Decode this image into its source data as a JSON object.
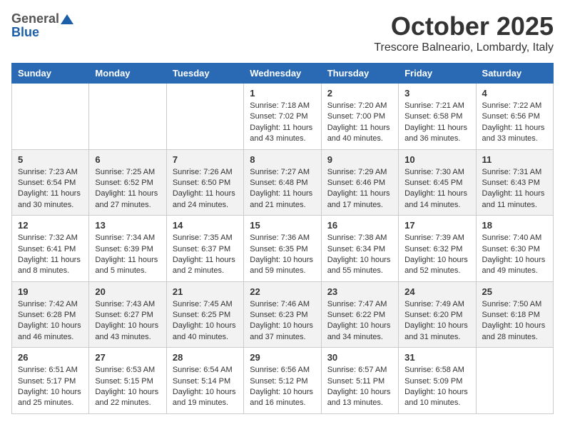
{
  "logo": {
    "general": "General",
    "blue": "Blue"
  },
  "header": {
    "month": "October 2025",
    "location": "Trescore Balneario, Lombardy, Italy"
  },
  "weekdays": [
    "Sunday",
    "Monday",
    "Tuesday",
    "Wednesday",
    "Thursday",
    "Friday",
    "Saturday"
  ],
  "weeks": [
    [
      {
        "day": "",
        "info": ""
      },
      {
        "day": "",
        "info": ""
      },
      {
        "day": "",
        "info": ""
      },
      {
        "day": "1",
        "info": "Sunrise: 7:18 AM\nSunset: 7:02 PM\nDaylight: 11 hours and 43 minutes."
      },
      {
        "day": "2",
        "info": "Sunrise: 7:20 AM\nSunset: 7:00 PM\nDaylight: 11 hours and 40 minutes."
      },
      {
        "day": "3",
        "info": "Sunrise: 7:21 AM\nSunset: 6:58 PM\nDaylight: 11 hours and 36 minutes."
      },
      {
        "day": "4",
        "info": "Sunrise: 7:22 AM\nSunset: 6:56 PM\nDaylight: 11 hours and 33 minutes."
      }
    ],
    [
      {
        "day": "5",
        "info": "Sunrise: 7:23 AM\nSunset: 6:54 PM\nDaylight: 11 hours and 30 minutes."
      },
      {
        "day": "6",
        "info": "Sunrise: 7:25 AM\nSunset: 6:52 PM\nDaylight: 11 hours and 27 minutes."
      },
      {
        "day": "7",
        "info": "Sunrise: 7:26 AM\nSunset: 6:50 PM\nDaylight: 11 hours and 24 minutes."
      },
      {
        "day": "8",
        "info": "Sunrise: 7:27 AM\nSunset: 6:48 PM\nDaylight: 11 hours and 21 minutes."
      },
      {
        "day": "9",
        "info": "Sunrise: 7:29 AM\nSunset: 6:46 PM\nDaylight: 11 hours and 17 minutes."
      },
      {
        "day": "10",
        "info": "Sunrise: 7:30 AM\nSunset: 6:45 PM\nDaylight: 11 hours and 14 minutes."
      },
      {
        "day": "11",
        "info": "Sunrise: 7:31 AM\nSunset: 6:43 PM\nDaylight: 11 hours and 11 minutes."
      }
    ],
    [
      {
        "day": "12",
        "info": "Sunrise: 7:32 AM\nSunset: 6:41 PM\nDaylight: 11 hours and 8 minutes."
      },
      {
        "day": "13",
        "info": "Sunrise: 7:34 AM\nSunset: 6:39 PM\nDaylight: 11 hours and 5 minutes."
      },
      {
        "day": "14",
        "info": "Sunrise: 7:35 AM\nSunset: 6:37 PM\nDaylight: 11 hours and 2 minutes."
      },
      {
        "day": "15",
        "info": "Sunrise: 7:36 AM\nSunset: 6:35 PM\nDaylight: 10 hours and 59 minutes."
      },
      {
        "day": "16",
        "info": "Sunrise: 7:38 AM\nSunset: 6:34 PM\nDaylight: 10 hours and 55 minutes."
      },
      {
        "day": "17",
        "info": "Sunrise: 7:39 AM\nSunset: 6:32 PM\nDaylight: 10 hours and 52 minutes."
      },
      {
        "day": "18",
        "info": "Sunrise: 7:40 AM\nSunset: 6:30 PM\nDaylight: 10 hours and 49 minutes."
      }
    ],
    [
      {
        "day": "19",
        "info": "Sunrise: 7:42 AM\nSunset: 6:28 PM\nDaylight: 10 hours and 46 minutes."
      },
      {
        "day": "20",
        "info": "Sunrise: 7:43 AM\nSunset: 6:27 PM\nDaylight: 10 hours and 43 minutes."
      },
      {
        "day": "21",
        "info": "Sunrise: 7:45 AM\nSunset: 6:25 PM\nDaylight: 10 hours and 40 minutes."
      },
      {
        "day": "22",
        "info": "Sunrise: 7:46 AM\nSunset: 6:23 PM\nDaylight: 10 hours and 37 minutes."
      },
      {
        "day": "23",
        "info": "Sunrise: 7:47 AM\nSunset: 6:22 PM\nDaylight: 10 hours and 34 minutes."
      },
      {
        "day": "24",
        "info": "Sunrise: 7:49 AM\nSunset: 6:20 PM\nDaylight: 10 hours and 31 minutes."
      },
      {
        "day": "25",
        "info": "Sunrise: 7:50 AM\nSunset: 6:18 PM\nDaylight: 10 hours and 28 minutes."
      }
    ],
    [
      {
        "day": "26",
        "info": "Sunrise: 6:51 AM\nSunset: 5:17 PM\nDaylight: 10 hours and 25 minutes."
      },
      {
        "day": "27",
        "info": "Sunrise: 6:53 AM\nSunset: 5:15 PM\nDaylight: 10 hours and 22 minutes."
      },
      {
        "day": "28",
        "info": "Sunrise: 6:54 AM\nSunset: 5:14 PM\nDaylight: 10 hours and 19 minutes."
      },
      {
        "day": "29",
        "info": "Sunrise: 6:56 AM\nSunset: 5:12 PM\nDaylight: 10 hours and 16 minutes."
      },
      {
        "day": "30",
        "info": "Sunrise: 6:57 AM\nSunset: 5:11 PM\nDaylight: 10 hours and 13 minutes."
      },
      {
        "day": "31",
        "info": "Sunrise: 6:58 AM\nSunset: 5:09 PM\nDaylight: 10 hours and 10 minutes."
      },
      {
        "day": "",
        "info": ""
      }
    ]
  ]
}
